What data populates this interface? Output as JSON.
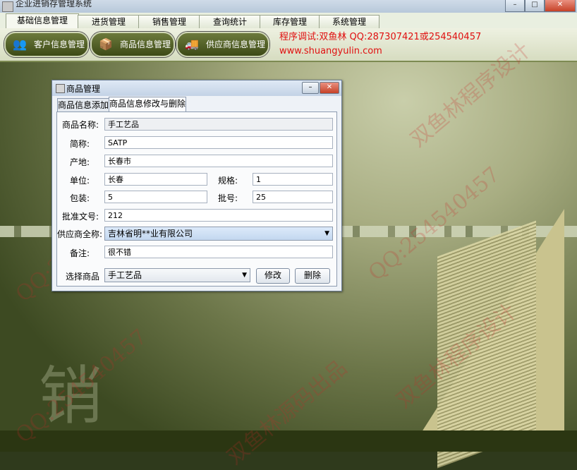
{
  "window": {
    "title": "企业进销存管理系统",
    "controls": [
      "–",
      "□",
      "✕"
    ]
  },
  "tabs": [
    {
      "label": "基础信息管理",
      "active": true
    },
    {
      "label": "进货管理"
    },
    {
      "label": "销售管理"
    },
    {
      "label": "查询统计"
    },
    {
      "label": "库存管理"
    },
    {
      "label": "系统管理"
    }
  ],
  "toolbar": {
    "buttons": [
      {
        "label": "客户信息管理",
        "icon": "👥"
      },
      {
        "label": "商品信息管理",
        "icon": "📦"
      },
      {
        "label": "供应商信息管理",
        "icon": "🚚"
      }
    ],
    "promo_line1": "程序调试:双鱼林 QQ:287307421或254540457",
    "promo_line2": "www.shuangyulin.com"
  },
  "dialog": {
    "title": "商品管理",
    "tabs": [
      {
        "label": "商品信息添加"
      },
      {
        "label": "商品信息修改与删除",
        "active": true
      }
    ],
    "fields": {
      "name_label": "商品名称:",
      "name_value": "手工艺品",
      "short_label": "简称:",
      "short_value": "SATP",
      "origin_label": "产地:",
      "origin_value": "长春市",
      "unit_label": "单位:",
      "unit_value": "长春",
      "spec_label": "规格:",
      "spec_value": "1",
      "pack_label": "包装:",
      "pack_value": "5",
      "batch_label": "批号:",
      "batch_value": "25",
      "approval_label": "批准文号:",
      "approval_value": "212",
      "supplier_label": "供应商全称:",
      "supplier_value": "吉林省明**业有限公司",
      "remark_label": "备注:",
      "remark_value": "很不错",
      "select_label": "选择商品",
      "select_value": "手工艺品"
    },
    "buttons": {
      "modify": "修改",
      "delete": "删除"
    }
  },
  "background": {
    "big_char": "销",
    "watermarks": [
      "QQ:254540457",
      "双鱼林源码出品",
      "双鱼林程序设计",
      "QQ:254540457",
      "双鱼林程序设计",
      "QQ:254540457"
    ]
  }
}
